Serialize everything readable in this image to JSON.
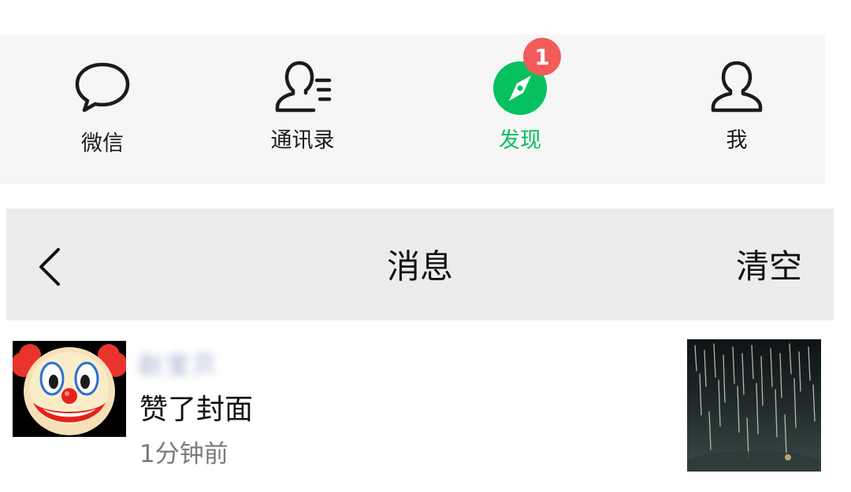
{
  "tabbar": {
    "tabs": [
      {
        "label": "微信",
        "icon": "chat-bubble-icon"
      },
      {
        "label": "通讯录",
        "icon": "contacts-icon"
      },
      {
        "label": "发现",
        "icon": "compass-icon",
        "badge": "1",
        "active": true
      },
      {
        "label": "我",
        "icon": "person-icon"
      }
    ],
    "active_color": "#07c160",
    "badge_color": "#f35b5b"
  },
  "navbar": {
    "back_icon": "chevron-left-icon",
    "title": "消息",
    "clear_label": "清空"
  },
  "message": {
    "avatar_icon": "clown-face-avatar",
    "username": "赵宝贝",
    "text": "赞了封面",
    "time": "1分钟前",
    "thumbnail": "fireworks-photo"
  }
}
